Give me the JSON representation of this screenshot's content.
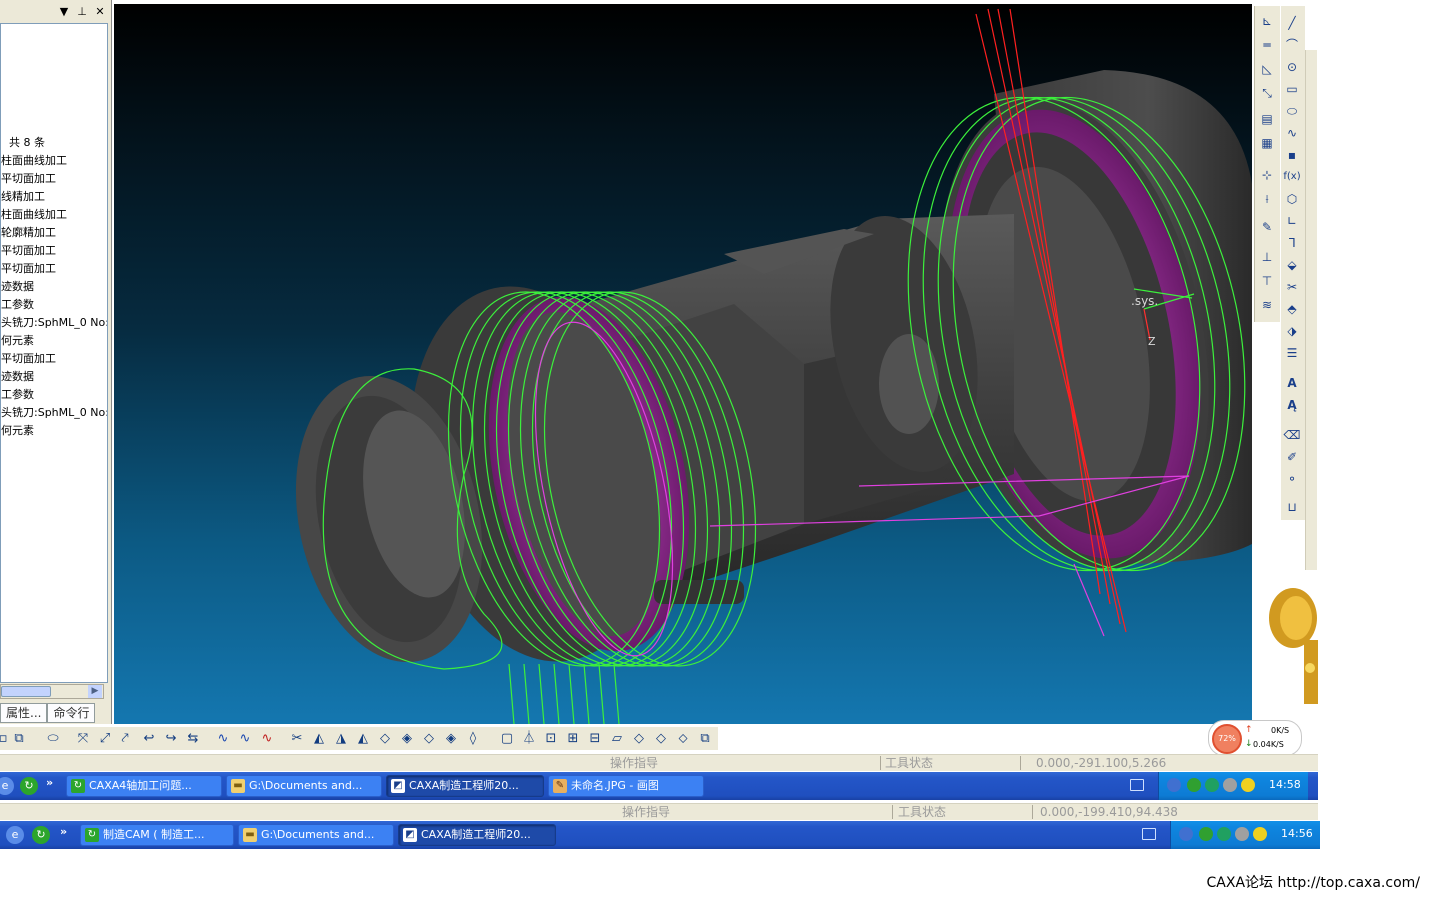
{
  "left_panel": {
    "title_controls": [
      "▼",
      "⊥",
      "✕"
    ],
    "tree_items": [
      "共 8 条",
      "柱面曲线加工",
      "平切面加工",
      "线精加工",
      "柱面曲线加工",
      "轮廓精加工",
      "平切面加工",
      "平切面加工",
      "迹数据",
      "工参数",
      "头铣刀:SphML_0 No:",
      "何元素",
      "平切面加工",
      "迹数据",
      "工参数",
      "头铣刀:SphML_0 No:",
      "何元素"
    ],
    "tabs": [
      "属性...",
      "命令行"
    ]
  },
  "viewport": {
    "sys_label": ".sys.",
    "axis_z": "Z"
  },
  "net_meter": {
    "percent": "72%",
    "upload": "0K/S",
    "download": "0.04K/S"
  },
  "status_bar_1": {
    "guide": "操作指导",
    "tool_state": "工具状态",
    "coords": "0.000,-291.100,5.266"
  },
  "taskbar_1": {
    "buttons": [
      "CAXA4轴加工问题...",
      "G:\\Documents and...",
      "CAXA制造工程师20...",
      "未命名.JPG - 画图"
    ],
    "clock": "14:58"
  },
  "status_bar_2": {
    "guide": "操作指导",
    "tool_state": "工具状态",
    "coords": "0.000,-199.410,94.438"
  },
  "taskbar_2": {
    "buttons": [
      "制造CAM ( 制造工...",
      "G:\\Documents and...",
      "CAXA制造工程师20..."
    ],
    "clock": "14:56"
  },
  "footer": {
    "text": "CAXA论坛 http://top.caxa.com/"
  },
  "colors": {
    "toolpath_green": "#3cf03c",
    "toolpath_magenta": "#e040e0",
    "toolpath_red": "#ff2020",
    "taskbar_blue": "#2456c8"
  }
}
